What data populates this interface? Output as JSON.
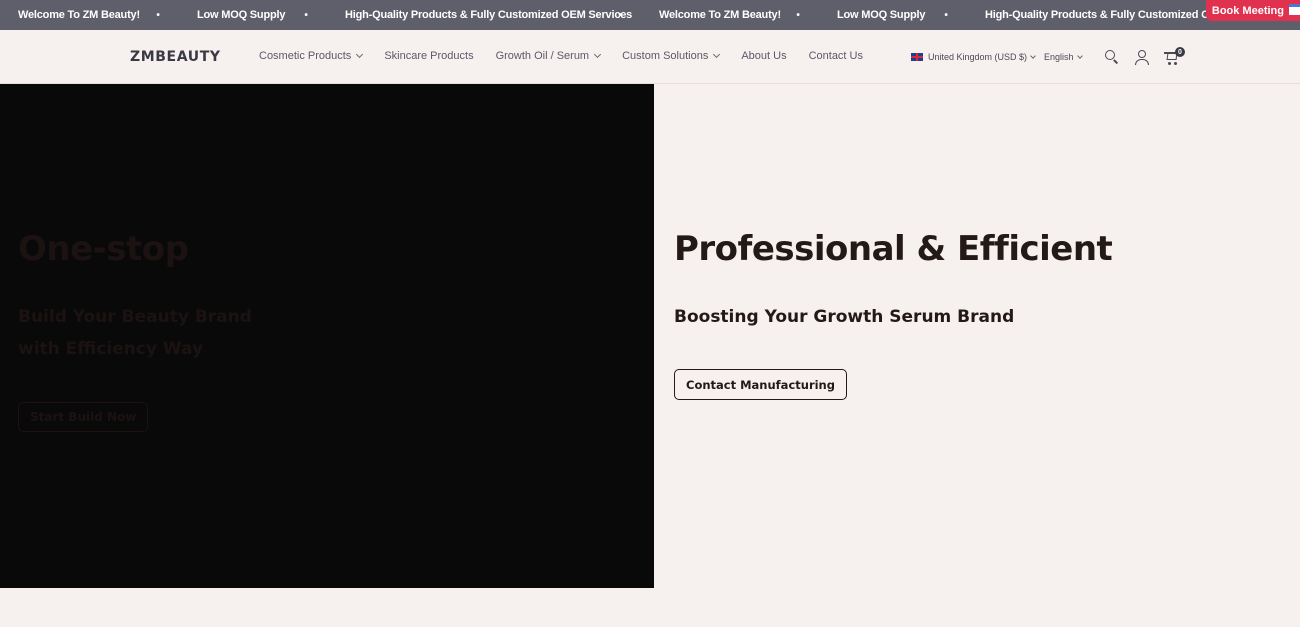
{
  "announcement": {
    "messages": [
      "Welcome To ZM Beauty!",
      "Low MOQ Supply",
      "High-Quality Products & Fully Customized OEM Services",
      "Welcome To ZM Beauty!",
      "Low MOQ Supply",
      "High-Quality Products & Fully Customized OEM Services"
    ],
    "separator": "•",
    "book_meeting": "Book Meeting"
  },
  "header": {
    "logo": "ZMBEAUTY",
    "nav": [
      {
        "label": "Cosmetic Products",
        "dropdown": true
      },
      {
        "label": "Skincare Products",
        "dropdown": false
      },
      {
        "label": "Growth Oil / Serum",
        "dropdown": true
      },
      {
        "label": "Custom Solutions",
        "dropdown": true
      },
      {
        "label": "About Us",
        "dropdown": false
      },
      {
        "label": "Contact Us",
        "dropdown": false
      }
    ],
    "region": "United Kingdom (USD $)",
    "language": "English",
    "cart_count": "0",
    "icons": [
      "search-icon",
      "account-icon",
      "cart-icon"
    ]
  },
  "hero": {
    "left": {
      "title": "One-stop",
      "subtitle_line1": "Build Your Beauty Brand",
      "subtitle_line2": "with Efficiency Way",
      "button": "Start Build Now"
    },
    "right": {
      "title": "Professional & Efficient",
      "subtitle": "Boosting Your Growth Serum Brand",
      "button": "Contact Manufacturing"
    }
  },
  "colors": {
    "topbar": "#5f5f6b",
    "accent": "#e0314f",
    "background": "#f6f0ef",
    "hero_dark": "#090909",
    "text_dark": "#231a18"
  }
}
